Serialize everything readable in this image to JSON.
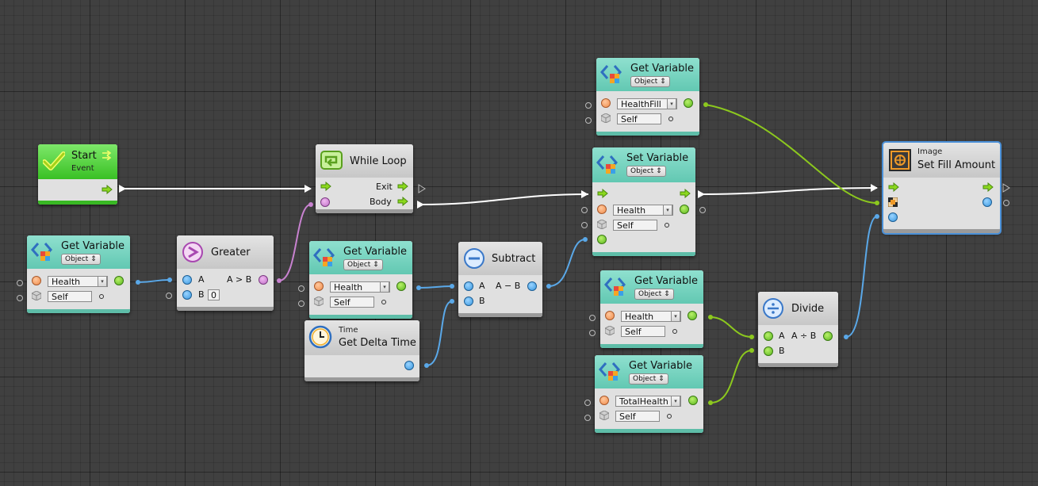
{
  "colors": {
    "canvas": "#404040",
    "teal_header": "#7bd6c2",
    "gray_header": "#d4d4d4",
    "green_header": "#52cf3a",
    "wire_exec": "#ffffff",
    "wire_float": "#5aa8e8",
    "wire_object": "#8cc81e",
    "wire_bool": "#c882d0",
    "port_orange": "#f08d4c",
    "port_green": "#6cc22a",
    "port_blue": "#3a98e0",
    "port_purple": "#c070c8"
  },
  "nodes": {
    "start": {
      "title": "Start",
      "subtitle": "Event"
    },
    "getvar_health_1": {
      "title": "Get Variable",
      "type": "Object",
      "var": "Health",
      "target": "Self"
    },
    "greater": {
      "title": "Greater",
      "a": "A",
      "b": "B",
      "out": "A > B",
      "b_value": "0"
    },
    "while_loop": {
      "title": "While Loop",
      "exit": "Exit",
      "body": "Body"
    },
    "getvar_health_2": {
      "title": "Get Variable",
      "type": "Object",
      "var": "Health",
      "target": "Self"
    },
    "delta_time": {
      "category": "Time",
      "title": "Get Delta Time"
    },
    "subtract": {
      "title": "Subtract",
      "a": "A",
      "b": "B",
      "out": "A − B"
    },
    "getvar_healthfill": {
      "title": "Get Variable",
      "type": "Object",
      "var": "HealthFill",
      "target": "Self"
    },
    "setvar_health": {
      "title": "Set Variable",
      "type": "Object",
      "var": "Health",
      "target": "Self"
    },
    "getvar_health_3": {
      "title": "Get Variable",
      "type": "Object",
      "var": "Health",
      "target": "Self"
    },
    "getvar_totalhealth": {
      "title": "Get Variable",
      "type": "Object",
      "var": "TotalHealth",
      "target": "Self"
    },
    "divide": {
      "title": "Divide",
      "a": "A",
      "b": "B",
      "out": "A ÷ B"
    },
    "set_fill": {
      "category": "Image",
      "title": "Set Fill Amount"
    }
  },
  "icons": {
    "variable": "variable-icon",
    "check": "checkmark-icon",
    "loop": "loop-icon",
    "greater": "greater-than-icon",
    "minus": "minus-icon",
    "divide": "divide-icon",
    "clock": "clock-icon",
    "image": "image-icon",
    "cube": "gameobject-icon"
  }
}
